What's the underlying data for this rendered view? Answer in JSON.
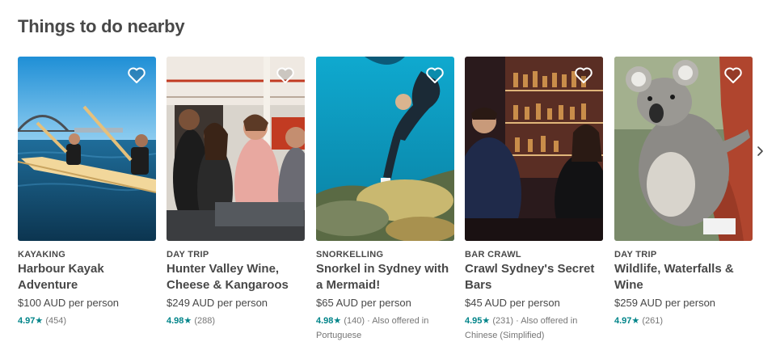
{
  "section": {
    "title": "Things to do nearby"
  },
  "cards": [
    {
      "category": "KAYAKING",
      "title": "Harbour Kayak Adventure",
      "price": "$100 AUD per person",
      "rating": "4.97",
      "reviews": "(454)",
      "extra": ""
    },
    {
      "category": "DAY TRIP",
      "title": "Hunter Valley Wine, Cheese & Kangaroos",
      "price": "$249 AUD per person",
      "rating": "4.98",
      "reviews": "(288)",
      "extra": ""
    },
    {
      "category": "SNORKELLING",
      "title": "Snorkel in Sydney with a Mermaid!",
      "price": "$65 AUD per person",
      "rating": "4.98",
      "reviews": "(140)",
      "extra": " · Also offered in Portuguese"
    },
    {
      "category": "BAR CRAWL",
      "title": "Crawl Sydney's Secret Bars",
      "price": "$45 AUD per person",
      "rating": "4.95",
      "reviews": "(231)",
      "extra": " · Also offered in Chinese (Simplified)"
    },
    {
      "category": "DAY TRIP",
      "title": "Wildlife, Waterfalls & Wine",
      "price": "$259 AUD per person",
      "rating": "4.97",
      "reviews": "(261)",
      "extra": ""
    }
  ],
  "icons": {
    "favorite": "heart-outline-icon",
    "star": "star-icon",
    "next": "chevron-right-icon"
  },
  "colors": {
    "text": "#484848",
    "muted": "#767676",
    "rating": "#008489"
  }
}
